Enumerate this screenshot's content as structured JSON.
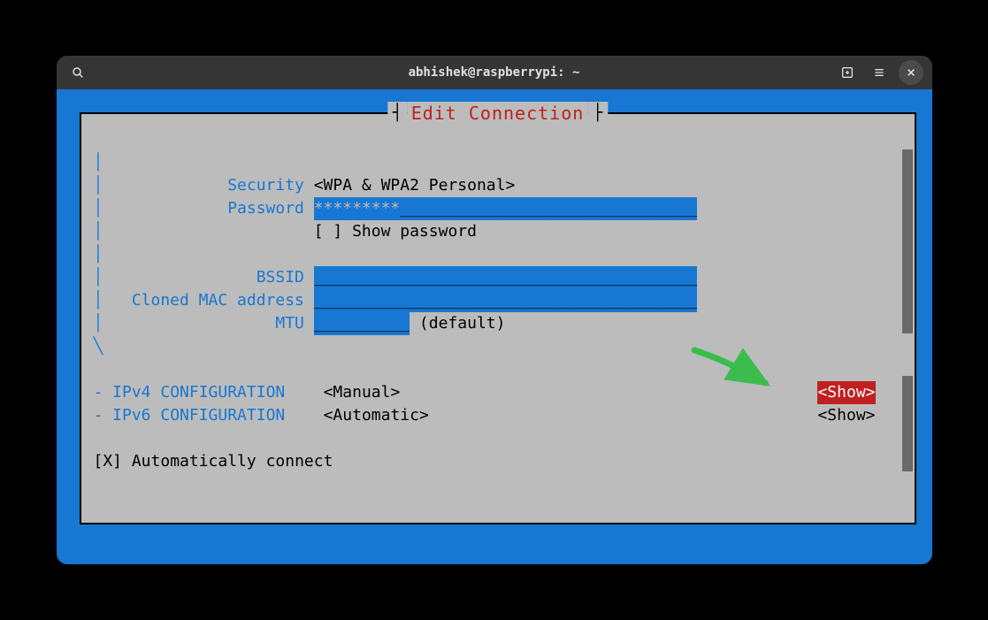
{
  "window": {
    "title": "abhishek@raspberrypi: ~"
  },
  "tui": {
    "title": "Edit Connection",
    "fields": {
      "security_label": "Security",
      "security_value": "<WPA & WPA2 Personal>",
      "password_label": "Password",
      "password_value": "*********",
      "password_underscores": "_______________________________",
      "show_password_checkbox": "[ ]",
      "show_password_label": "Show password",
      "bssid_label": "BSSID",
      "bssid_underscores": "________________________________________",
      "cloned_mac_label": "Cloned MAC address",
      "cloned_mac_underscores": "________________________________________",
      "mtu_label": "MTU",
      "mtu_underscores": "__________",
      "mtu_default": "(default)"
    },
    "ipv4": {
      "heading": "- IPv4 CONFIGURATION",
      "mode": "<Manual>",
      "show": "<Show>"
    },
    "ipv6": {
      "heading": "- IPv6 CONFIGURATION",
      "mode": "<Automatic>",
      "show": "<Show>"
    },
    "auto_connect": "[X] Automatically connect"
  }
}
